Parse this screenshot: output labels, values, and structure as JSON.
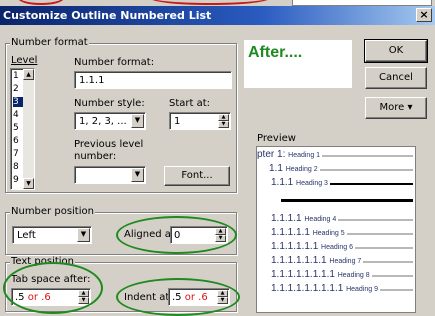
{
  "dialog": {
    "title": "Customize Outline Numbered List",
    "close_glyph": "×"
  },
  "number_format": {
    "group_label": "Number format",
    "level_label": "Level",
    "levels": [
      "1",
      "2",
      "3",
      "4",
      "5",
      "6",
      "7",
      "8",
      "9"
    ],
    "selected_level": "3",
    "format_label": "Number format:",
    "format_value": "1.1.1",
    "style_label": "Number style:",
    "style_value": "1, 2, 3, ...",
    "start_label": "Start at:",
    "start_value": "1",
    "previous_label_1": "Previous level",
    "previous_label_2": "number:",
    "previous_value": "",
    "font_button": "Font..."
  },
  "buttons": {
    "ok": "OK",
    "cancel": "Cancel",
    "more": "More ▾"
  },
  "annotation": {
    "after": "After....",
    "accent": "#1f8a1f"
  },
  "number_position": {
    "group_label": "Number position",
    "alignment_value": "Left",
    "aligned_label": "Aligned at:",
    "aligned_value": "0"
  },
  "text_position": {
    "group_label": "Text position",
    "tab_label": "Tab space after:",
    "tab_value_a": ".5",
    "tab_or": "or",
    "tab_value_b": ".6",
    "indent_label": "Indent at:",
    "indent_value_a": ".5",
    "indent_or": "or",
    "indent_value_b": ".6"
  },
  "preview": {
    "label": "Preview",
    "rows": [
      {
        "num": "pter 1:",
        "head": "Heading 1"
      },
      {
        "num": "1.1",
        "head": "Heading 2"
      },
      {
        "num": "1.1.1",
        "head": "Heading 3"
      },
      {
        "num": "1.1.1.1",
        "head": "Heading 4"
      },
      {
        "num": "1.1.1.1.1",
        "head": "Heading 5"
      },
      {
        "num": "1.1.1.1.1.1",
        "head": "Heading 6"
      },
      {
        "num": "1.1.1.1.1.1.1",
        "head": "Heading 7"
      },
      {
        "num": "1.1.1.1.1.1.1.1",
        "head": "Heading 8"
      },
      {
        "num": "1.1.1.1.1.1.1.1.1",
        "head": "Heading 9"
      }
    ]
  }
}
